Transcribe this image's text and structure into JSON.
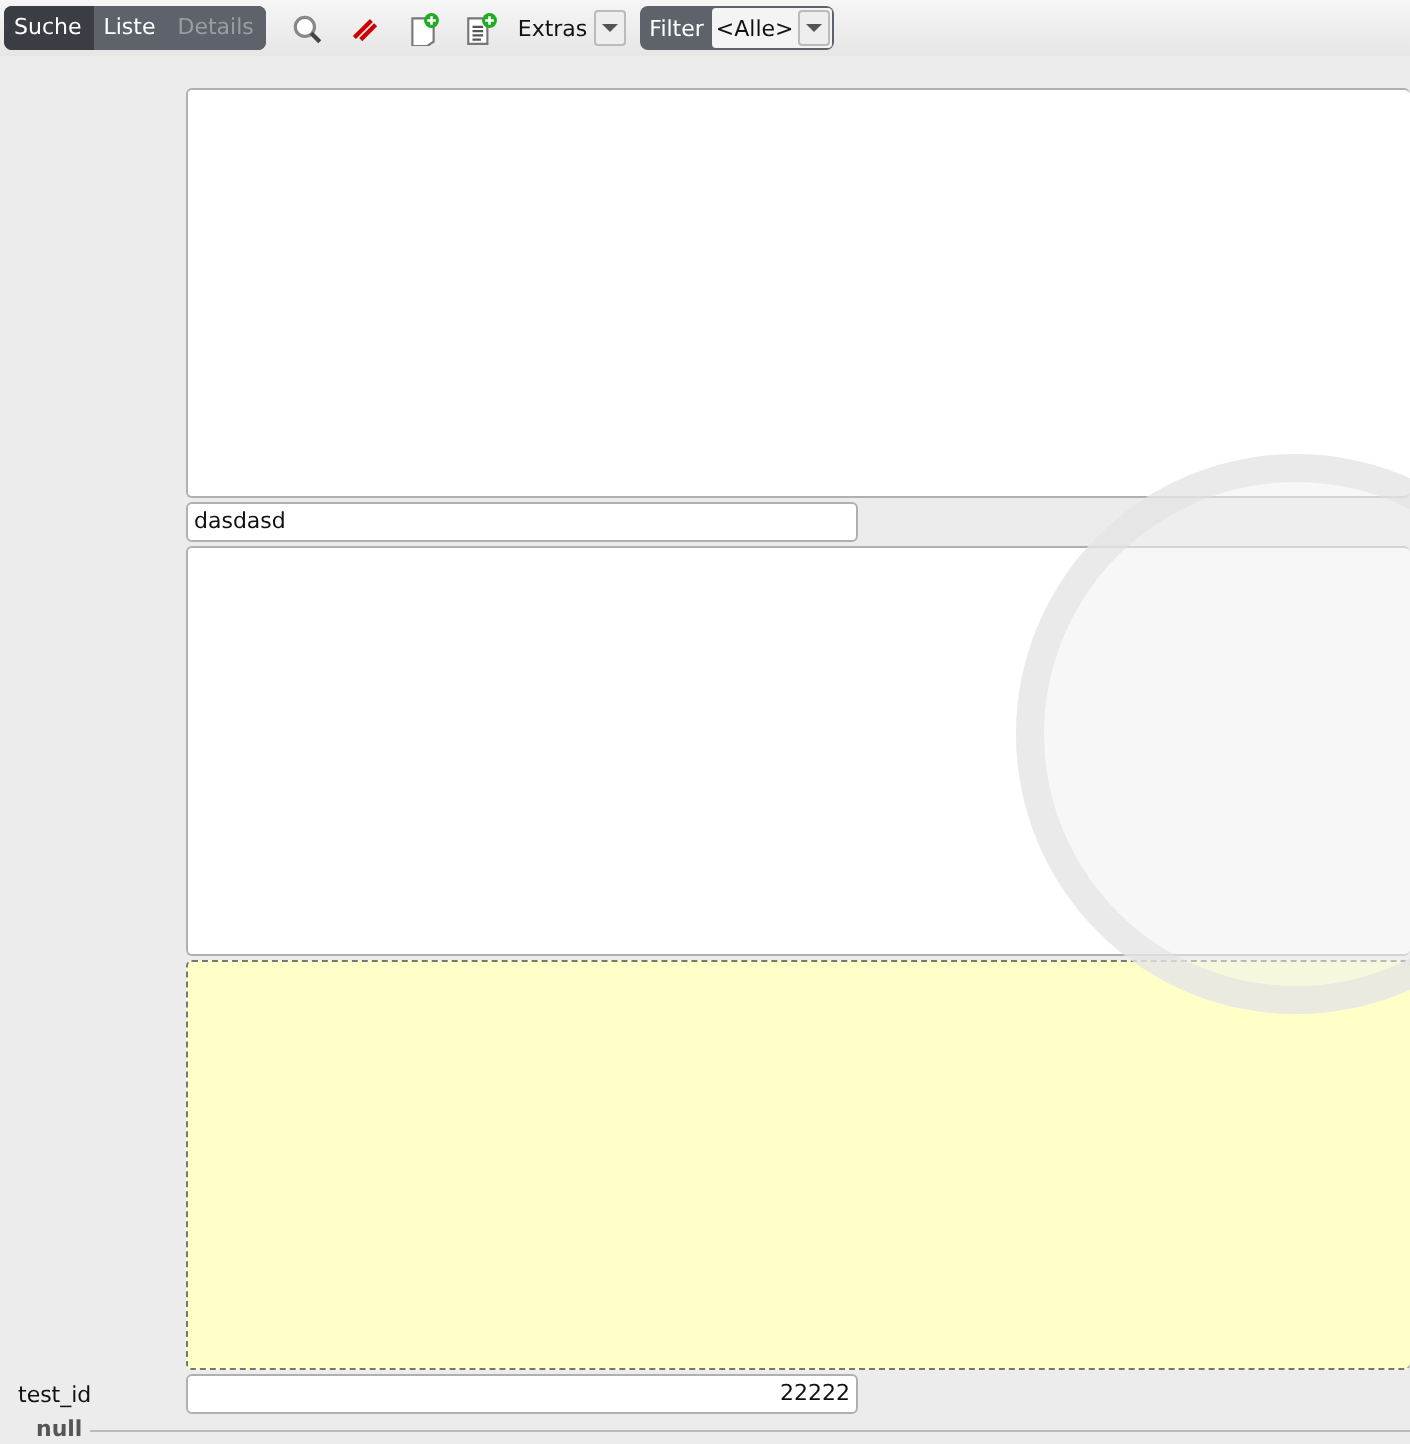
{
  "breadcrumb": [
    {
      "label": "Suche",
      "selected": true,
      "disabled": false
    },
    {
      "label": "Liste",
      "selected": false,
      "disabled": false
    },
    {
      "label": "Details",
      "selected": false,
      "disabled": true
    }
  ],
  "toolbar": {
    "tools": [
      {
        "kind": "search"
      },
      {
        "kind": "eraser"
      },
      {
        "kind": "new"
      },
      {
        "kind": "new-list"
      }
    ],
    "extras": {
      "label": "Extras"
    },
    "filter": {
      "label": "Filter",
      "value": "<Alle>"
    }
  },
  "form": {
    "fields": [
      {
        "kind": "textarea",
        "focused": false
      },
      {
        "kind": "text",
        "value": "dasdasd"
      },
      {
        "kind": "textarea",
        "focused": false
      },
      {
        "kind": "textarea",
        "focused": true
      },
      {
        "kind": "number",
        "label": "test_id",
        "value": "22222"
      }
    ],
    "group": {
      "legend": "null"
    }
  }
}
